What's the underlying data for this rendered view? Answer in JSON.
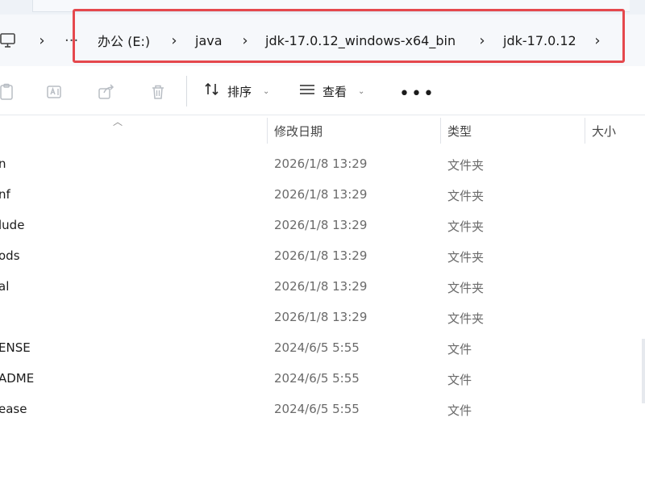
{
  "address_bar": {
    "dots": "···",
    "crumbs": [
      {
        "label": "办公 (E:)"
      },
      {
        "label": "java"
      },
      {
        "label": "jdk-17.0.12_windows-x64_bin"
      },
      {
        "label": "jdk-17.0.12"
      }
    ]
  },
  "toolbar": {
    "sort_label": "排序",
    "view_label": "查看",
    "more_label": "•••"
  },
  "columns": {
    "date": "修改日期",
    "type": "类型",
    "size": "大小"
  },
  "files": [
    {
      "name": "n",
      "date": "2026/1/8 13:29",
      "type": "文件夹"
    },
    {
      "name": "nf",
      "date": "2026/1/8 13:29",
      "type": "文件夹"
    },
    {
      "name": "lude",
      "date": "2026/1/8 13:29",
      "type": "文件夹"
    },
    {
      "name": "ods",
      "date": "2026/1/8 13:29",
      "type": "文件夹"
    },
    {
      "name": "al",
      "date": "2026/1/8 13:29",
      "type": "文件夹"
    },
    {
      "name": "",
      "date": "2026/1/8 13:29",
      "type": "文件夹"
    },
    {
      "name": "ENSE",
      "date": "2024/6/5 5:55",
      "type": "文件"
    },
    {
      "name": "ADME",
      "date": "2024/6/5 5:55",
      "type": "文件"
    },
    {
      "name": "ease",
      "date": "2024/6/5 5:55",
      "type": "文件"
    }
  ]
}
